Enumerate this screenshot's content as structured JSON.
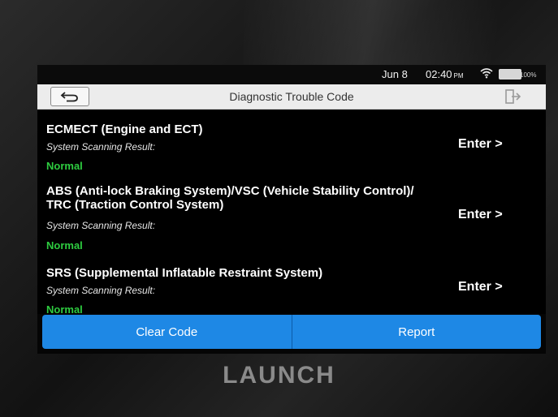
{
  "status_bar": {
    "date": "Jun 8",
    "time": "02:40",
    "ampm": "PM",
    "battery": "100%"
  },
  "title_bar": {
    "title": "Diagnostic Trouble Code",
    "back_icon": "back-arrow-icon",
    "exit_icon": "exit-icon"
  },
  "systems": [
    {
      "name": "ECMECT (Engine and ECT)",
      "scan_label": "System Scanning Result:",
      "status": "Normal",
      "enter_label": "Enter >"
    },
    {
      "name": "ABS (Anti-lock Braking System)/VSC (Vehicle Stability Control)/ TRC (Traction Control System)",
      "scan_label": "System Scanning Result:",
      "status": "Normal",
      "enter_label": "Enter >"
    },
    {
      "name": "SRS (Supplemental Inflatable Restraint System)",
      "scan_label": "System Scanning Result:",
      "status": "Normal",
      "enter_label": "Enter >"
    }
  ],
  "actions": {
    "clear_code": "Clear Code",
    "report": "Report"
  },
  "colors": {
    "accent": "#1e88e5",
    "status_normal": "#2ecc40"
  },
  "device": {
    "brand": "LAUNCH"
  }
}
